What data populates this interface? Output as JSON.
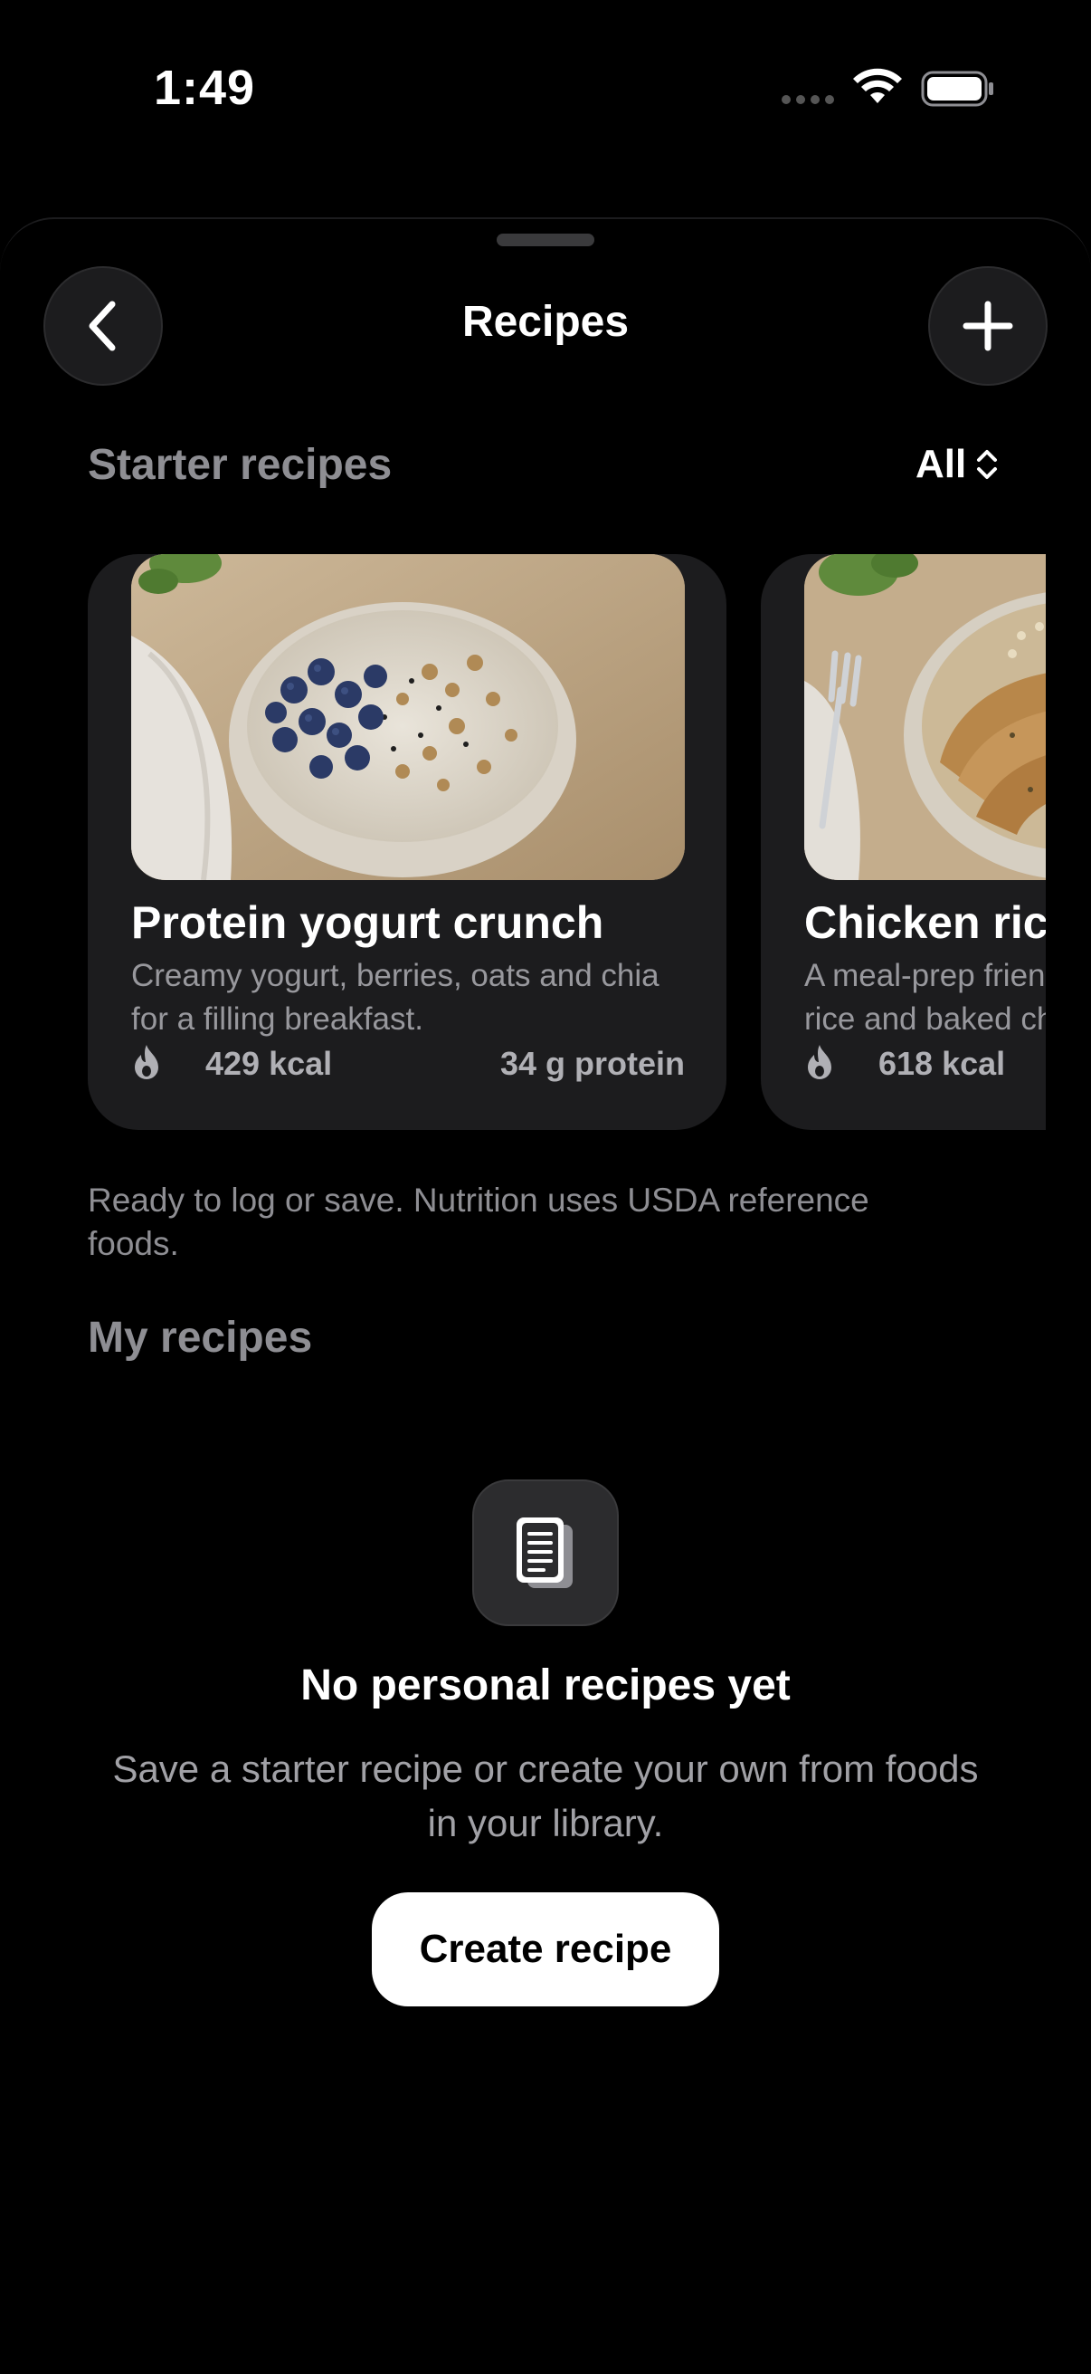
{
  "status_bar": {
    "time": "1:49"
  },
  "nav": {
    "title": "Recipes"
  },
  "starter": {
    "title": "Starter recipes",
    "filter_label": "All",
    "cards": [
      {
        "title": "Protein yogurt crunch",
        "description": "Creamy yogurt, berries, oats and chia for a filling breakfast.",
        "kcal": "429 kcal",
        "protein": "34 g protein"
      },
      {
        "title": "Chicken rice",
        "description": "A meal-prep friendly bowl with brown rice and baked chicken.",
        "kcal": "618 kcal",
        "protein": ""
      }
    ],
    "note": "Ready to log or save. Nutrition uses USDA reference foods."
  },
  "my_recipes": {
    "title": "My recipes",
    "empty_title": "No personal recipes yet",
    "empty_description": "Save a starter recipe or create your own from foods in your library.",
    "create_label": "Create recipe"
  },
  "icons": {
    "back": "chevron-left-icon",
    "add": "plus-icon",
    "filter": "chevron-up-down-icon",
    "calories": "flame-icon",
    "empty": "document-icon"
  },
  "colors": {
    "background": "#000000",
    "card": "#1c1c1e",
    "secondary_text": "#8e8e93",
    "button": "#ffffff"
  }
}
